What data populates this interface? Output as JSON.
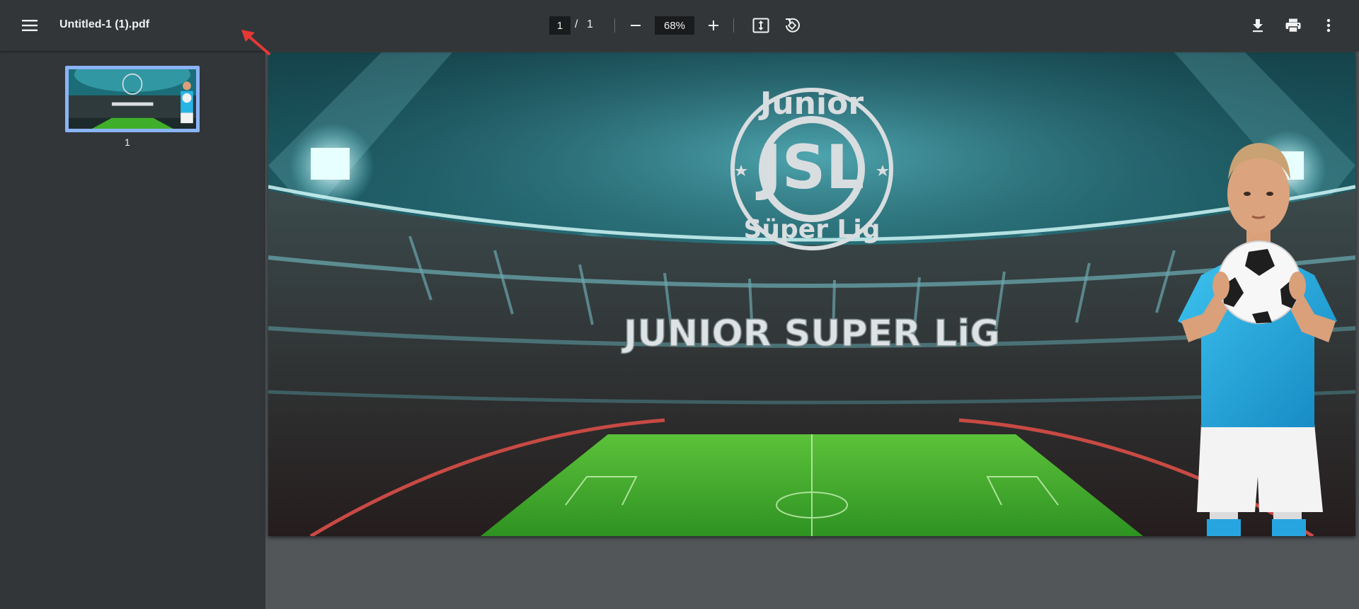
{
  "toolbar": {
    "file_name": "Untitled-1 (1).pdf",
    "page_current": "1",
    "page_separator": "/",
    "page_total": "1",
    "zoom": "68%"
  },
  "sidebar": {
    "thumbnails": [
      {
        "page_label": "1"
      }
    ]
  },
  "document": {
    "logo_top_text": "Junior",
    "logo_monogram": "JSL",
    "logo_bottom_text": "Süper Lig",
    "banner_title": "JUNIOR SUPER LiG"
  },
  "colors": {
    "toolbar_bg": "#323639",
    "viewer_bg": "#525659",
    "thumb_border": "#8ab4f8",
    "annotation_arrow": "#e53935",
    "jersey": "#27b5e6",
    "pitch": "#3fae2a"
  },
  "icons": {
    "menu": "hamburger-menu-icon",
    "zoom_out": "minus-icon",
    "zoom_in": "plus-icon",
    "fit": "fit-to-page-icon",
    "rotate": "rotate-counterclockwise-icon",
    "download": "download-icon",
    "print": "print-icon",
    "more": "more-vertical-icon"
  }
}
